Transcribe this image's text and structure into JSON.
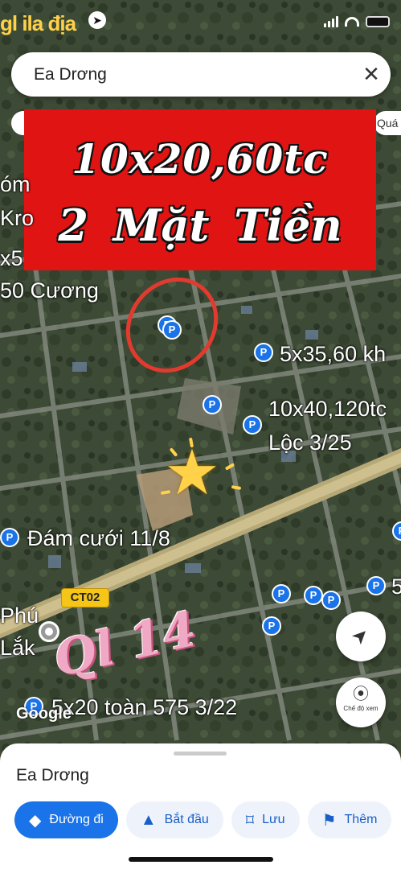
{
  "status_bar": {
    "carrier": "gl ila địa",
    "location_glyph": "➤"
  },
  "search": {
    "query": "Ea Drơng",
    "clear_glyph": "✕"
  },
  "chip_right": {
    "label": "Quá"
  },
  "banner": {
    "line1": "10x20,60tc",
    "line2": "2 Mặt Tiền",
    "color": "#e11414"
  },
  "map_labels": [
    {
      "text": "óm"
    },
    {
      "text": "Kro"
    },
    {
      "text": "x5"
    },
    {
      "text": "50 Cương"
    },
    {
      "text": "5x35,60 kh"
    },
    {
      "text": "10x40,120tc"
    },
    {
      "text": "Lộc 3/25"
    },
    {
      "text": "Đám cưới 11/8"
    },
    {
      "text": "5"
    },
    {
      "text": "Phú"
    },
    {
      "text": "Lắk"
    },
    {
      "text": "5x20 toàn 575 3/22"
    }
  ],
  "pin_glyph": "P",
  "road_tag": "CT02",
  "overlay_text": "Ql 14",
  "google_logo": "Google",
  "buttons": {
    "navigate_glyph": "➤",
    "view_glyph": "⦿",
    "view_label": "Chế độ xem"
  },
  "sheet": {
    "title": "Ea Drơng",
    "actions": [
      {
        "label": "Đường đi",
        "icon": "◆"
      },
      {
        "label": "Bắt đầu",
        "icon": "▲"
      },
      {
        "label": "Lưu",
        "icon": "⌑"
      },
      {
        "label": "Thêm",
        "icon": "⚑"
      }
    ]
  },
  "colors": {
    "accent": "#1a73e8",
    "pin": "#1a73e8",
    "circle": "#e23a2f"
  }
}
